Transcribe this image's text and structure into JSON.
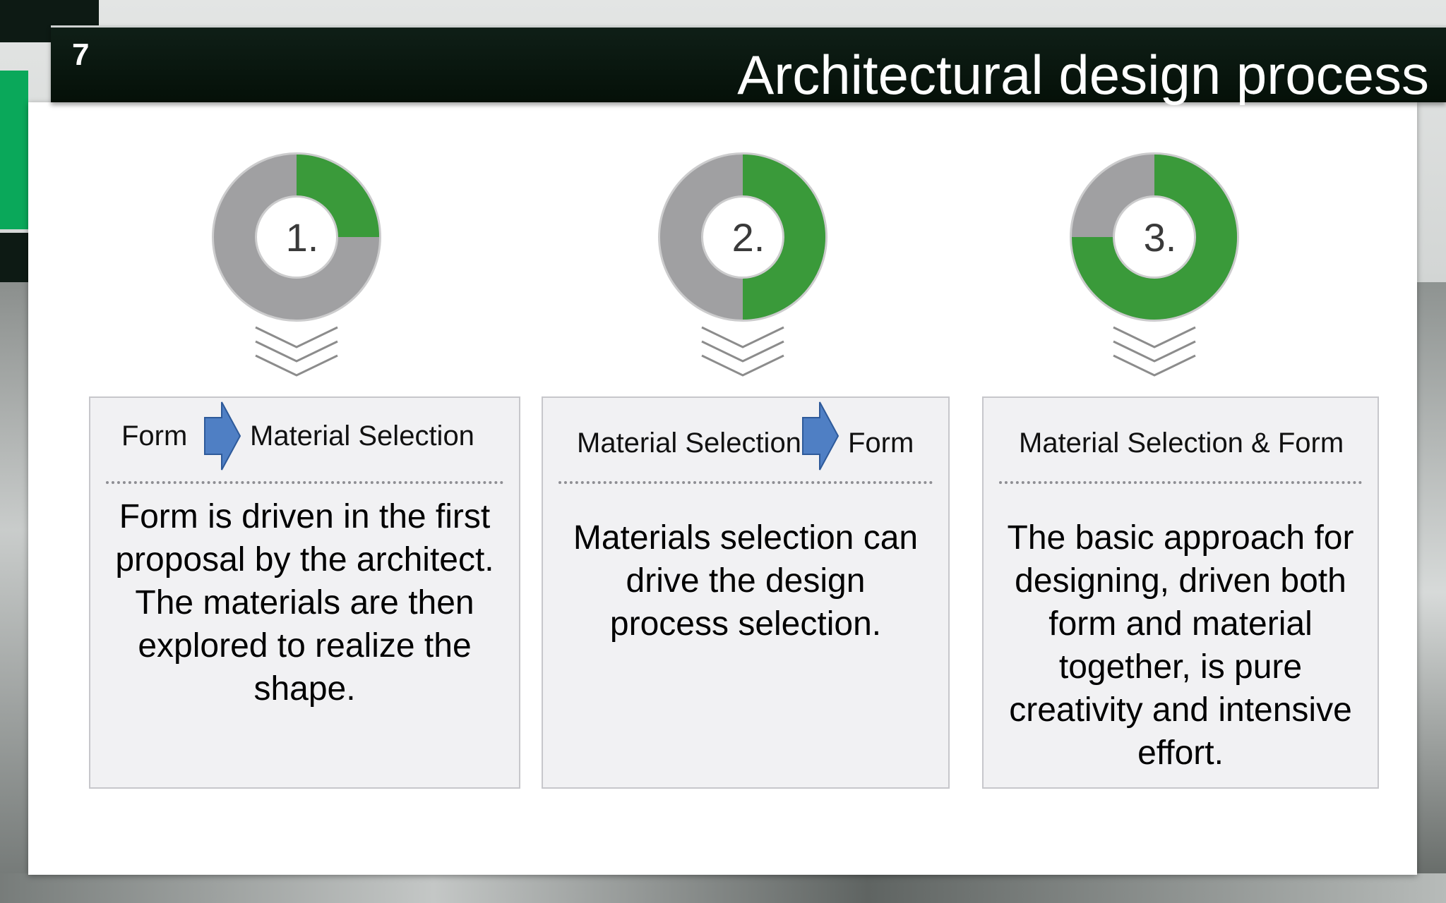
{
  "slide": {
    "number": "7",
    "title": "Architectural design process"
  },
  "colors": {
    "accent_green": "#3a9a3a",
    "donut_grey": "#a0a0a2",
    "arrow_blue": "#4f7fc4",
    "title_bar": "#0a160f"
  },
  "steps": [
    {
      "label": "1.",
      "green_fraction": 0.25,
      "header_left": "Form",
      "header_right": "Material Selection",
      "body": "Form is driven in the first proposal by the architect. The materials are then explored to realize the shape."
    },
    {
      "label": "2.",
      "green_fraction": 0.5,
      "header_left": "Material Selection",
      "header_right": "Form",
      "body": "Materials selection can drive the design process selection."
    },
    {
      "label": "3.",
      "green_fraction": 0.75,
      "header_left": "Material Selection & Form",
      "body": "The basic approach for designing, driven both form and material together, is pure creativity and intensive effort."
    }
  ]
}
